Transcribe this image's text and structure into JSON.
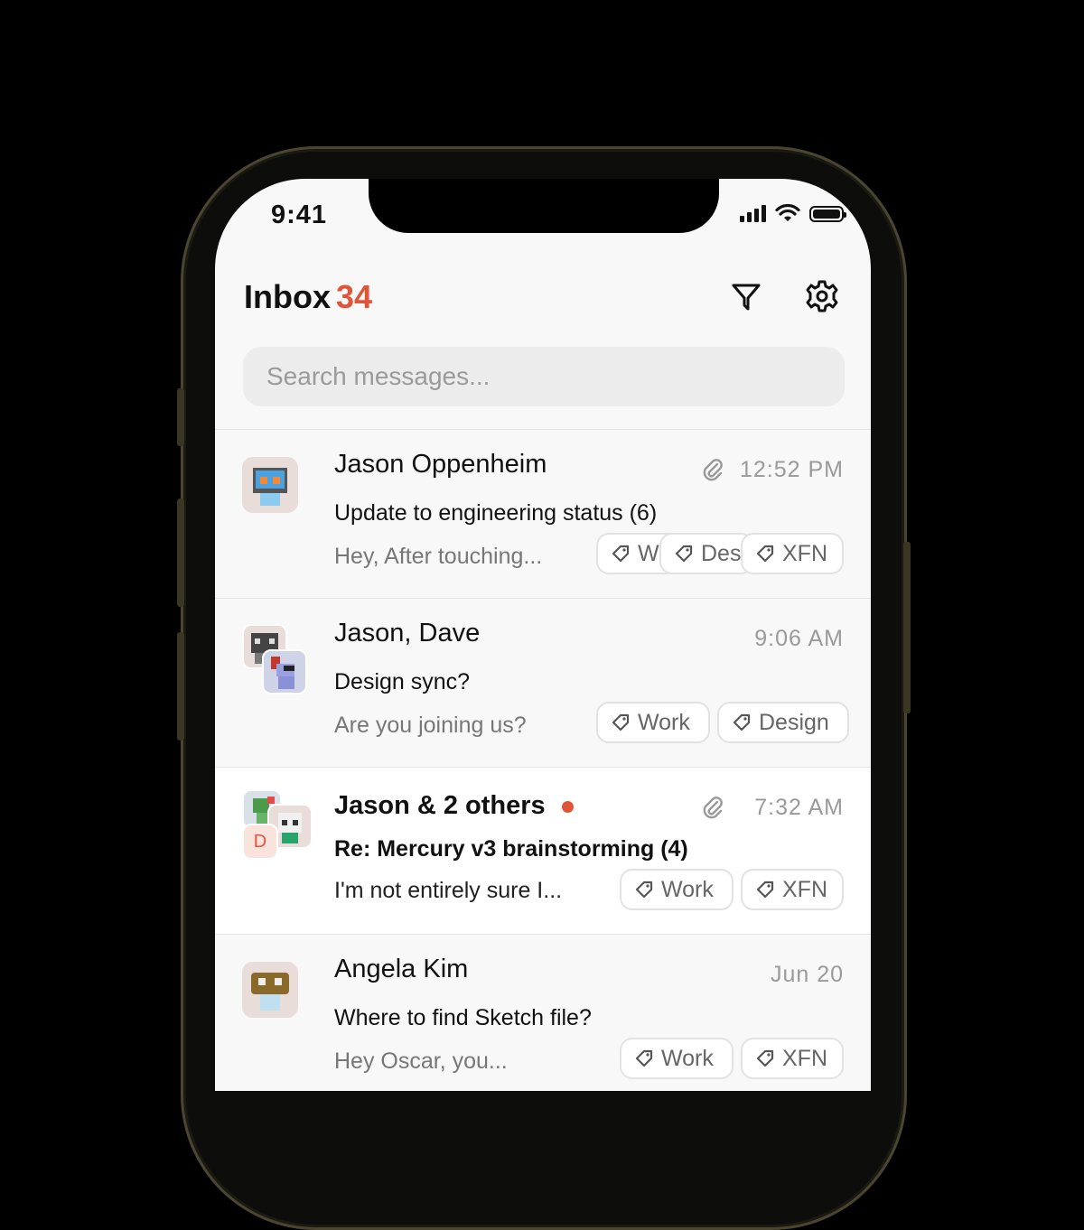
{
  "status_bar": {
    "time": "9:41"
  },
  "header": {
    "title": "Inbox",
    "count": "34"
  },
  "search": {
    "placeholder": "Search messages..."
  },
  "messages": [
    {
      "sender": "Jason Oppenheim",
      "time": "12:52 PM",
      "subject": "Update to engineering status (6)",
      "preview": "Hey, After touching...",
      "has_attachment": true,
      "unread": false,
      "tags": [
        "Work",
        "Design",
        "XFN"
      ]
    },
    {
      "sender": "Jason, Dave",
      "time": "9:06 AM",
      "subject": "Design sync?",
      "preview": "Are you joining us?",
      "has_attachment": false,
      "unread": false,
      "tags": [
        "Work",
        "Design"
      ]
    },
    {
      "sender": "Jason & 2 others",
      "time": "7:32 AM",
      "subject": "Re: Mercury v3 brainstorming (4)",
      "preview": "I'm not entirely sure I...",
      "has_attachment": true,
      "unread": true,
      "avatar_letter": "D",
      "tags": [
        "Work",
        "XFN"
      ]
    },
    {
      "sender": "Angela Kim",
      "time": "Jun 20",
      "subject": "Where to find Sketch file?",
      "preview": "Hey Oscar, you...",
      "has_attachment": false,
      "unread": false,
      "tags": [
        "Work",
        "XFN"
      ]
    }
  ],
  "colors": {
    "accent": "#e0553a",
    "background": "#f8f8f8"
  }
}
